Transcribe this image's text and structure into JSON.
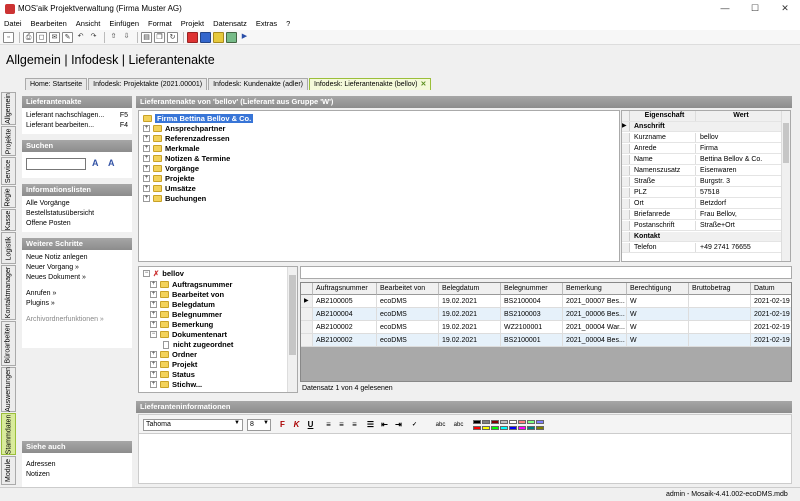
{
  "window": {
    "title": "MOS'aik Projektverwaltung (Firma Muster AG)",
    "min": "—",
    "max": "☐",
    "close": "✕"
  },
  "menu": [
    "Datei",
    "Bearbeiten",
    "Ansicht",
    "Einfügen",
    "Format",
    "Projekt",
    "Datensatz",
    "Extras",
    "?"
  ],
  "page_title": "Allgemein | Infodesk | Lieferantenakte",
  "tabs": [
    {
      "label": "Home: Startseite",
      "active": false
    },
    {
      "label": "Infodesk: Projektakte (2021.00001)",
      "active": false
    },
    {
      "label": "Infodesk: Kundenakte (adler)",
      "active": false
    },
    {
      "label": "Infodesk: Lieferantenakte (bellov)",
      "active": true
    }
  ],
  "vertical_tabs": [
    "Allgemein",
    "Projekte",
    "Service",
    "Regie",
    "Kasse",
    "Logistik",
    "Kontaktmanager",
    "Büroarbeiten",
    "Auswertungen",
    "Stammdaten",
    "Module"
  ],
  "left": {
    "lieferantenakte": {
      "header": "Lieferantenakte",
      "items": [
        {
          "label": "Lieferant nachschlagen...",
          "key": "F5"
        },
        {
          "label": "Lieferant bearbeiten...",
          "key": "F4"
        }
      ]
    },
    "suchen": {
      "header": "Suchen"
    },
    "informationslisten": {
      "header": "Informationslisten",
      "items": [
        "Alle Vorgänge",
        "Bestellstatusübersicht",
        "Offene Posten"
      ]
    },
    "weitere": {
      "header": "Weitere Schritte",
      "items": [
        "Neue Notiz anlegen",
        "Neuer Vorgang »",
        "Neues Dokument »",
        "Anrufen »",
        "Plugins »",
        "Archivordnerfunktionen »"
      ]
    },
    "siehe_auch": {
      "header": "Siehe auch",
      "items": [
        "Adressen",
        "Notizen"
      ]
    }
  },
  "main_header": "Lieferantenakte von 'bellov' (Lieferant aus Gruppe 'W')",
  "tree_top": {
    "root": "Firma Bettina Bellov & Co.",
    "children": [
      "Ansprechpartner",
      "Referenzadressen",
      "Merkmale",
      "Notizen & Termine",
      "Vorgänge",
      "Projekte",
      "Umsätze",
      "Buchungen"
    ]
  },
  "properties": {
    "col_eigenschaft": "Eigenschaft",
    "col_wert": "Wert",
    "rows": [
      {
        "group": "Anschrift"
      },
      {
        "k": "Kurzname",
        "v": "bellov"
      },
      {
        "k": "Anrede",
        "v": "Firma"
      },
      {
        "k": "Name",
        "v": "Bettina Bellov & Co."
      },
      {
        "k": "Namenszusatz",
        "v": "Eisenwaren"
      },
      {
        "k": "Straße",
        "v": "Burgstr. 3"
      },
      {
        "k": "PLZ",
        "v": "57518"
      },
      {
        "k": "Ort",
        "v": "Betzdorf"
      },
      {
        "k": "Briefanrede",
        "v": " Frau Bellov,"
      },
      {
        "k": "Postanschrift",
        "v": "Straße+Ort"
      },
      {
        "group": "Kontakt"
      },
      {
        "k": "Telefon",
        "v": "+49 2741 76655"
      }
    ]
  },
  "tree_bottom": {
    "root": "bellov",
    "items": [
      "Auftragsnummer",
      "Bearbeitet von",
      "Belegdatum",
      "Belegnummer",
      "Bemerkung",
      "Dokumentenart",
      "nicht zugeordnet",
      "Ordner",
      "Projekt",
      "Status",
      "Stichw..."
    ]
  },
  "grid": {
    "columns": [
      "Auftragsnummer",
      "Bearbeitet von",
      "Belegdatum",
      "Belegnummer",
      "Bemerkung",
      "Berechtigung",
      "Bruttobetrag",
      "Datum"
    ],
    "rows": [
      [
        "AB2100005",
        "ecoDMS",
        "19.02.2021",
        "BS2100004",
        "2021_00007 Bes...",
        "W",
        "",
        "2021-02-19"
      ],
      [
        "AB2100004",
        "ecoDMS",
        "19.02.2021",
        "BS2100003",
        "2021_00006 Bes...",
        "W",
        "",
        "2021-02-19"
      ],
      [
        "AB2100002",
        "ecoDMS",
        "19.02.2021",
        "WZ2100001",
        "2021_00004 War...",
        "W",
        "",
        "2021-02-19"
      ],
      [
        "AB2100002",
        "ecoDMS",
        "19.02.2021",
        "BS2100001",
        "2021_00004 Bes...",
        "W",
        "",
        "2021-02-19"
      ]
    ],
    "status": "Datensatz 1 von 4 gelesenen"
  },
  "lieferanteninfo": {
    "header": "Lieferanteninformationen",
    "font": "Tahoma",
    "size": "8"
  },
  "statusbar": "admin - Mosaik-4.41.002-ecoDMS.mdb",
  "colors": {
    "accent": "#9bbf3a",
    "selection": "#3875d7",
    "header_grey": "#999999"
  }
}
